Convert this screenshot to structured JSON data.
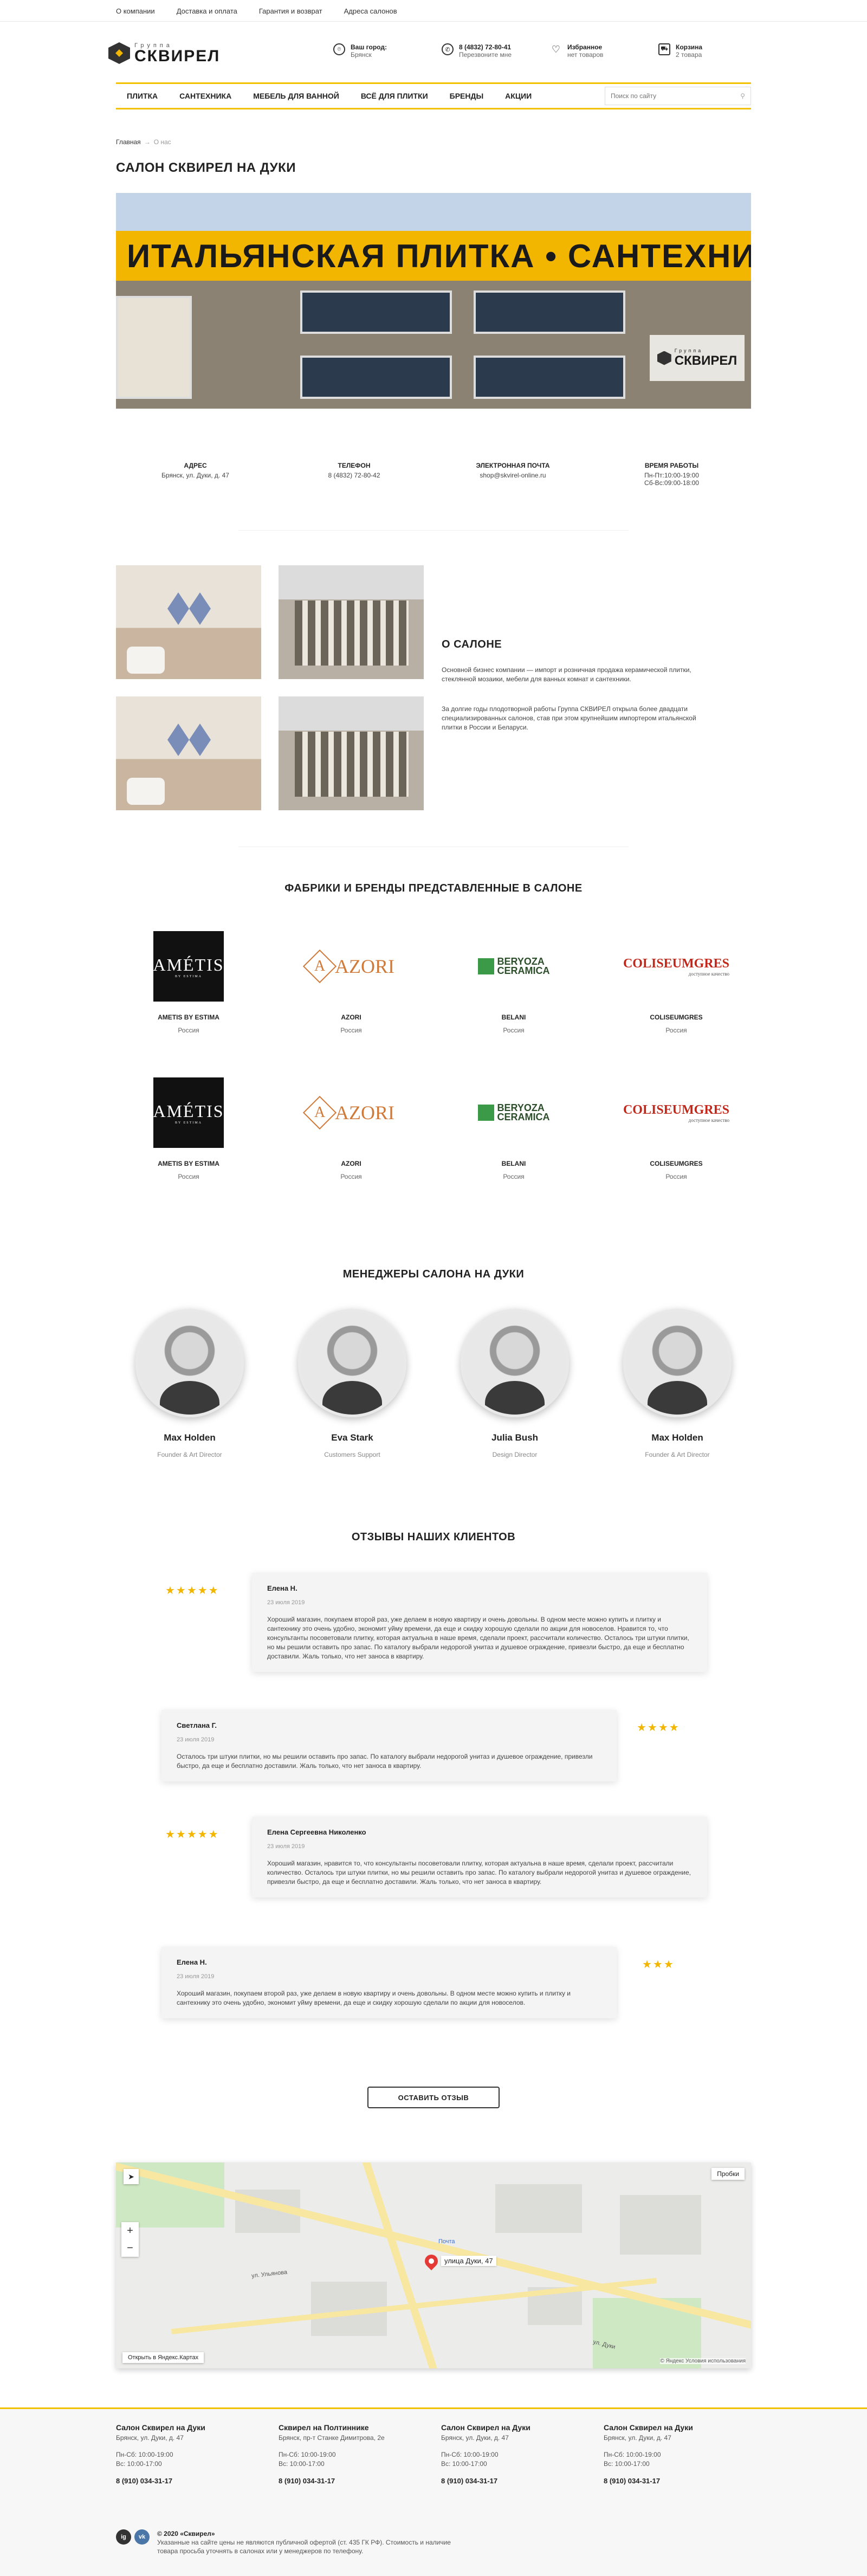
{
  "topbar": {
    "links": [
      "О компании",
      "Доставка и оплата",
      "Гарантия и возврат",
      "Адреса салонов"
    ]
  },
  "logo": {
    "small": "Группа",
    "big": "СКВИРЕЛ"
  },
  "header": {
    "city": {
      "label": "Ваш город:",
      "value": "Брянск",
      "icon": "location-icon"
    },
    "phone": {
      "label": "8 (4832) 72-80-41",
      "sub": "Перезвоните мне",
      "icon": "phone-icon"
    },
    "fav": {
      "label": "Избранное",
      "sub": "нет товаров",
      "icon": "heart-icon"
    },
    "cart": {
      "label": "Корзина",
      "sub": "2 товара",
      "icon": "cart-icon"
    }
  },
  "nav": {
    "items": [
      "Плитка",
      "Сантехника",
      "Мебель для ванной",
      "Всё для плитки",
      "Бренды",
      "Акции"
    ],
    "search_placeholder": "Поиск по сайту"
  },
  "breadcrumb": {
    "home": "Главная",
    "sep": "→",
    "current": "О нас"
  },
  "page_title": "САЛОН СКВИРЕЛ НА ДУКИ",
  "hero": {
    "sign": "ИТАЛЬЯНСКАЯ ПЛИТКА • САНТЕХНИКА",
    "plate_small": "Группа",
    "plate_big": "СКВИРЕЛ"
  },
  "contacts": [
    {
      "title": "Адрес",
      "lines": [
        "Брянск, ул. Дуки, д. 47"
      ]
    },
    {
      "title": "Телефон",
      "lines": [
        "8 (4832) 72-80-42"
      ]
    },
    {
      "title": "Электронная почта",
      "lines": [
        "shop@skvirel-online.ru"
      ]
    },
    {
      "title": "Время работы",
      "lines": [
        "Пн-Пт:10:00-19:00",
        "Сб-Вс:09:00-18:00"
      ]
    }
  ],
  "about": {
    "title": "О САЛОНЕ",
    "p1": "Основной бизнес компании — импорт и розничная продажа керамической плитки, стеклянной мозаики, мебели для ванных комнат и сантехники.",
    "p2": "За долгие годы плодотворной работы Группа СКВИРЕЛ открыла более двадцати специализированных салонов, став при этом крупнейшим импортером итальянской плитки в России и Беларуси."
  },
  "brands": {
    "title": "Фабрики и бренды представленные в салоне",
    "items": [
      {
        "name": "AMETIS BY ESTIMA",
        "country": "Россия",
        "logo": "AMÉTIS",
        "logo_sub": "BY ESTIMA"
      },
      {
        "name": "AZORI",
        "country": "Россия",
        "logo": "AZORI",
        "logo_mark": "A"
      },
      {
        "name": "BELANI",
        "country": "Россия",
        "logo_l1": "BERYOZA",
        "logo_l2": "CERAMICA"
      },
      {
        "name": "COLISEUMGRES",
        "country": "Россия",
        "logo": "COLISEUMGRES",
        "logo_sub": "доступное качество"
      },
      {
        "name": "AMETIS BY ESTIMA",
        "country": "Россия",
        "logo": "AMÉTIS",
        "logo_sub": "BY ESTIMA"
      },
      {
        "name": "AZORI",
        "country": "Россия",
        "logo": "AZORI",
        "logo_mark": "A"
      },
      {
        "name": "BELANI",
        "country": "Россия",
        "logo_l1": "BERYOZA",
        "logo_l2": "CERAMICA"
      },
      {
        "name": "COLISEUMGRES",
        "country": "Россия",
        "logo": "COLISEUMGRES",
        "logo_sub": "доступное качество"
      }
    ]
  },
  "managers": {
    "title": "Менеджеры салона на Дуки",
    "items": [
      {
        "name": "Max Holden",
        "role": "Founder & Art Director"
      },
      {
        "name": "Eva Stark",
        "role": "Customers Support"
      },
      {
        "name": "Julia Bush",
        "role": "Design Director"
      },
      {
        "name": "Max Holden",
        "role": "Founder & Art Director"
      }
    ]
  },
  "reviews": {
    "title": "Отзывы наших клиентов",
    "button": "Оставить отзыв",
    "items": [
      {
        "author": "Елена Н.",
        "date": "23 июля 2019",
        "stars": "★★★★★",
        "rating": 5,
        "text": "Хороший магазин, покупаем второй раз, уже делаем в новую квартиру и очень довольны. В одном месте можно купить и плитку и сантехнику это очень удобно, экономит уйму времени, да еще и скидку хорошую сделали по акции для новоселов. Нравится то, что консультанты посоветовали плитку, которая актуальна в наше время, сделали проект, рассчитали количество. Осталось три штуки плитки, но мы решили оставить про запас. По каталогу выбрали недорогой унитаз и душевое ограждение, привезли быстро, да еще и бесплатно доставили. Жаль только, что нет заноса в квартиру."
      },
      {
        "author": "Светлана Г.",
        "date": "23 июля 2019",
        "stars": "★★★★",
        "rating": 4,
        "text": "Осталось три штуки плитки, но мы решили оставить про запас. По каталогу выбрали недорогой унитаз и душевое ограждение, привезли быстро, да еще и бесплатно доставили. Жаль только, что нет заноса в квартиру."
      },
      {
        "author": "Елена Сергеевна Николенко",
        "date": "23 июля 2019",
        "stars": "★★★★★",
        "rating": 5,
        "text": "Хороший магазин, нравится то, что консультанты посоветовали плитку, которая актуальна в наше время, сделали проект, рассчитали количество. Осталось три штуки плитки, но мы решили оставить про запас. По каталогу выбрали недорогой унитаз и душевое ограждение, привезли быстро, да еще и бесплатно доставили. Жаль только, что нет заноса в квартиру."
      },
      {
        "author": "Елена Н.",
        "date": "23 июля 2019",
        "stars": "★★★",
        "rating": 3,
        "text": "Хороший магазин, покупаем второй раз, уже делаем в новую квартиру и очень довольны. В одном месте можно купить и плитку и сантехнику это очень удобно, экономит уйму времени, да еще и скидку хорошую сделали по акции для новоселов."
      }
    ]
  },
  "map": {
    "marker": "улица Дуки, 47",
    "open": "Открыть в Яндекс.Картах",
    "traffic": "Пробки",
    "copyright": "© Яндекс  Условия использования",
    "zoom_in": "+",
    "zoom_out": "−",
    "street1": "ул. Дуки",
    "street2": "Почта",
    "street3": "ул. Ульянова"
  },
  "footer": {
    "cols": [
      {
        "title": "Салон Сквирел на Дуки",
        "addr": "Брянск, ул. Дуки, д. 47",
        "h1": "Пн-Сб: 10:00-19:00",
        "h2": "Вс: 10:00-17:00",
        "phone": "8 (910) 034-31-17"
      },
      {
        "title": "Сквирел на Полтинникe",
        "addr": "Брянск, пр-т Станке Димитрова, 2е",
        "h1": "Пн-Сб: 10:00-19:00",
        "h2": "Вс: 10:00-17:00",
        "phone": "8 (910) 034-31-17"
      },
      {
        "title": "Салон Сквирел на Дуки",
        "addr": "Брянск, ул. Дуки, д. 47",
        "h1": "Пн-Сб: 10:00-19:00",
        "h2": "Вс: 10:00-17:00",
        "phone": "8 (910) 034-31-17"
      },
      {
        "title": "Салон Сквирел на Дуки",
        "addr": "Брянск, ул. Дуки, д. 47",
        "h1": "Пн-Сб: 10:00-19:00",
        "h2": "Вс: 10:00-17:00",
        "phone": "8 (910) 034-31-17"
      }
    ],
    "copyright": "© 2020 «Сквирел»",
    "note": "Указанные на сайте цены не являются публичной офертой (ст. 435 ГК РФ). Стоимость и наличие товара просьба уточнять в салонах или у менеджеров по телефону.",
    "social": [
      "ig",
      "vk"
    ]
  },
  "colors": {
    "accent": "#f2c200",
    "star": "#f2b500",
    "dark": "#222222"
  }
}
